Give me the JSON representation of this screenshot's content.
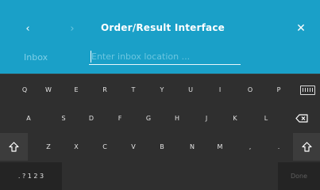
{
  "header": {
    "back_icon": "chevron-left-icon",
    "forward_icon": "chevron-right-icon",
    "close_icon": "close-icon",
    "title": "Order/Result Interface",
    "background": "#1aa0c8"
  },
  "field": {
    "label": "Inbox",
    "value": "",
    "placeholder": "Enter inbox location ..."
  },
  "keyboard": {
    "row1": [
      "Q",
      "W",
      "E",
      "R",
      "T",
      "Y",
      "U",
      "I",
      "O",
      "P"
    ],
    "row2": [
      "A",
      "S",
      "D",
      "F",
      "G",
      "H",
      "J",
      "K",
      "L"
    ],
    "row3": [
      "Z",
      "X",
      "C",
      "V",
      "B",
      "N",
      "M",
      ",",
      "."
    ],
    "mode_key": ". ? 1 2 3",
    "done_key": "Done",
    "icons": {
      "hide_keyboard": "keyboard-hide-icon",
      "backspace": "backspace-icon",
      "shift": "shift-icon"
    }
  }
}
